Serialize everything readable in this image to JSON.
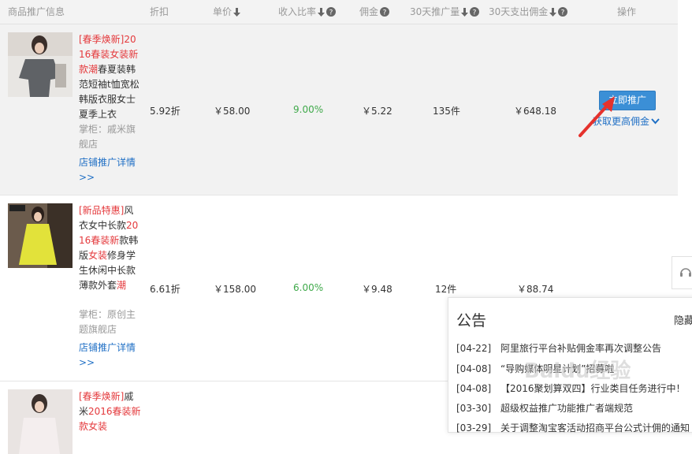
{
  "header": {
    "product": "商品推广信息",
    "discount": "折扣",
    "price": "单价",
    "income_ratio": "收入比率",
    "commission": "佣金",
    "volume_30d": "30天推广量",
    "spend_30d": "30天支出佣金",
    "operation": "操作"
  },
  "rows": [
    {
      "tag": "[春季焕新]",
      "title_red": "2016春装女装新款潮",
      "title_rest": "春夏装韩范短袖t恤宽松韩版衣服女士夏季上衣",
      "title_tail": "",
      "shop": "掌柜：戚米旗舰店",
      "link": "店铺推广详情>>",
      "discount": "5.92折",
      "price": "￥58.00",
      "ratio": "9.00%",
      "commission": "￥5.22",
      "volume": "135件",
      "spend": "￥648.18"
    },
    {
      "tag": "[新品特惠]",
      "title_red": "",
      "title_rest": "风衣女中长款",
      "title_red2": "2016春装新",
      "title_mid": "款韩版",
      "title_red3": "女装",
      "title_tail": "修身学生休闲中长款薄款外套",
      "title_red4": "潮",
      "shop": "掌柜：原创主题旗舰店",
      "link": "店铺推广详情>>",
      "discount": "6.61折",
      "price": "￥158.00",
      "ratio": "6.00%",
      "commission": "￥9.48",
      "volume": "12件",
      "spend": "￥88.74"
    },
    {
      "tag": "[春季焕新]",
      "title_rest": "戚米",
      "title_red2": "2016春装新款女装"
    }
  ],
  "actions": {
    "promote": "立即推广",
    "more": "获取更高佣金"
  },
  "notice": {
    "title": "公告",
    "hide": "隐藏",
    "items": [
      {
        "date": "[04-22]",
        "text": "阿里旅行平台补贴佣金率再次调整公告"
      },
      {
        "date": "[04-08]",
        "text": "“导购媒体明星计划”招募啦"
      },
      {
        "date": "[04-08]",
        "text": "【2016聚划算双四】行业类目任务进行中！"
      },
      {
        "date": "[03-30]",
        "text": "超级权益推广功能推广者端规范"
      },
      {
        "date": "[03-29]",
        "text": "关于调整淘宝客活动招商平台公式计佣的通知"
      }
    ]
  },
  "watermark": "Baidu经验",
  "colors": {
    "accent_red": "#e4393c",
    "link_blue": "#1f6fc5",
    "ratio_green": "#3fa94a",
    "button_blue": "#3b8fd6"
  }
}
